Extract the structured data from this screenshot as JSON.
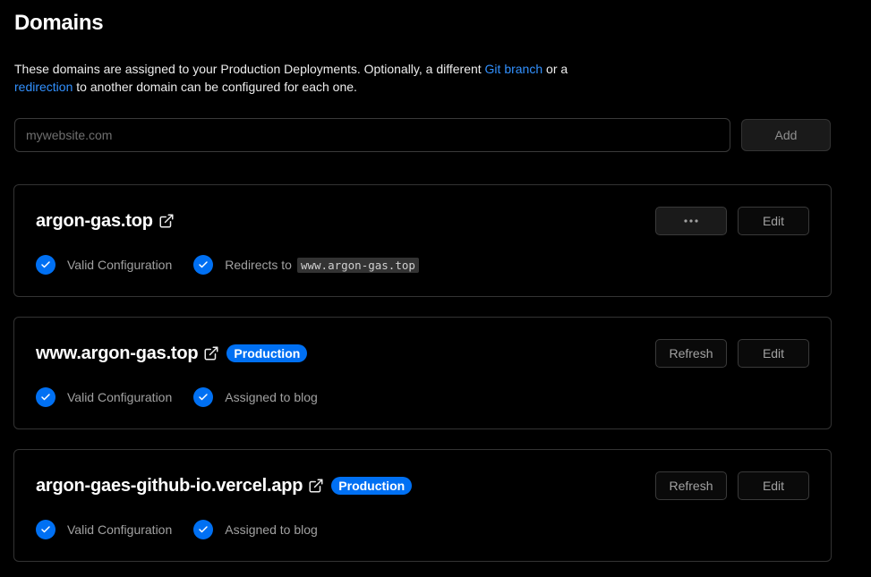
{
  "page": {
    "title": "Domains",
    "description": {
      "part1": "These domains are assigned to your Production Deployments. Optionally, a different ",
      "link1": "Git branch",
      "part2": " or a ",
      "link2": "redirection",
      "part3": " to another domain can be configured for each one."
    }
  },
  "add_form": {
    "placeholder": "mywebsite.com",
    "value": "",
    "add_label": "Add"
  },
  "colors": {
    "accent": "#0070f3",
    "link": "#3291ff",
    "border": "#333333",
    "background": "#000000"
  },
  "domains": [
    {
      "name": "argon-gas.top",
      "badge": "",
      "actions": {
        "more_label": "•••",
        "edit_label": "Edit"
      },
      "status": [
        {
          "icon": "check-circle-icon",
          "text": "Valid Configuration"
        },
        {
          "icon": "check-circle-icon",
          "text": "Redirects to",
          "target": "www.argon-gas.top"
        }
      ]
    },
    {
      "name": "www.argon-gas.top",
      "badge": "Production",
      "actions": {
        "refresh_label": "Refresh",
        "edit_label": "Edit"
      },
      "status": [
        {
          "icon": "check-circle-icon",
          "text": "Valid Configuration"
        },
        {
          "icon": "check-circle-icon",
          "text": "Assigned to blog"
        }
      ]
    },
    {
      "name": "argon-gaes-github-io.vercel.app",
      "badge": "Production",
      "actions": {
        "refresh_label": "Refresh",
        "edit_label": "Edit"
      },
      "status": [
        {
          "icon": "check-circle-icon",
          "text": "Valid Configuration"
        },
        {
          "icon": "check-circle-icon",
          "text": "Assigned to blog"
        }
      ]
    }
  ]
}
